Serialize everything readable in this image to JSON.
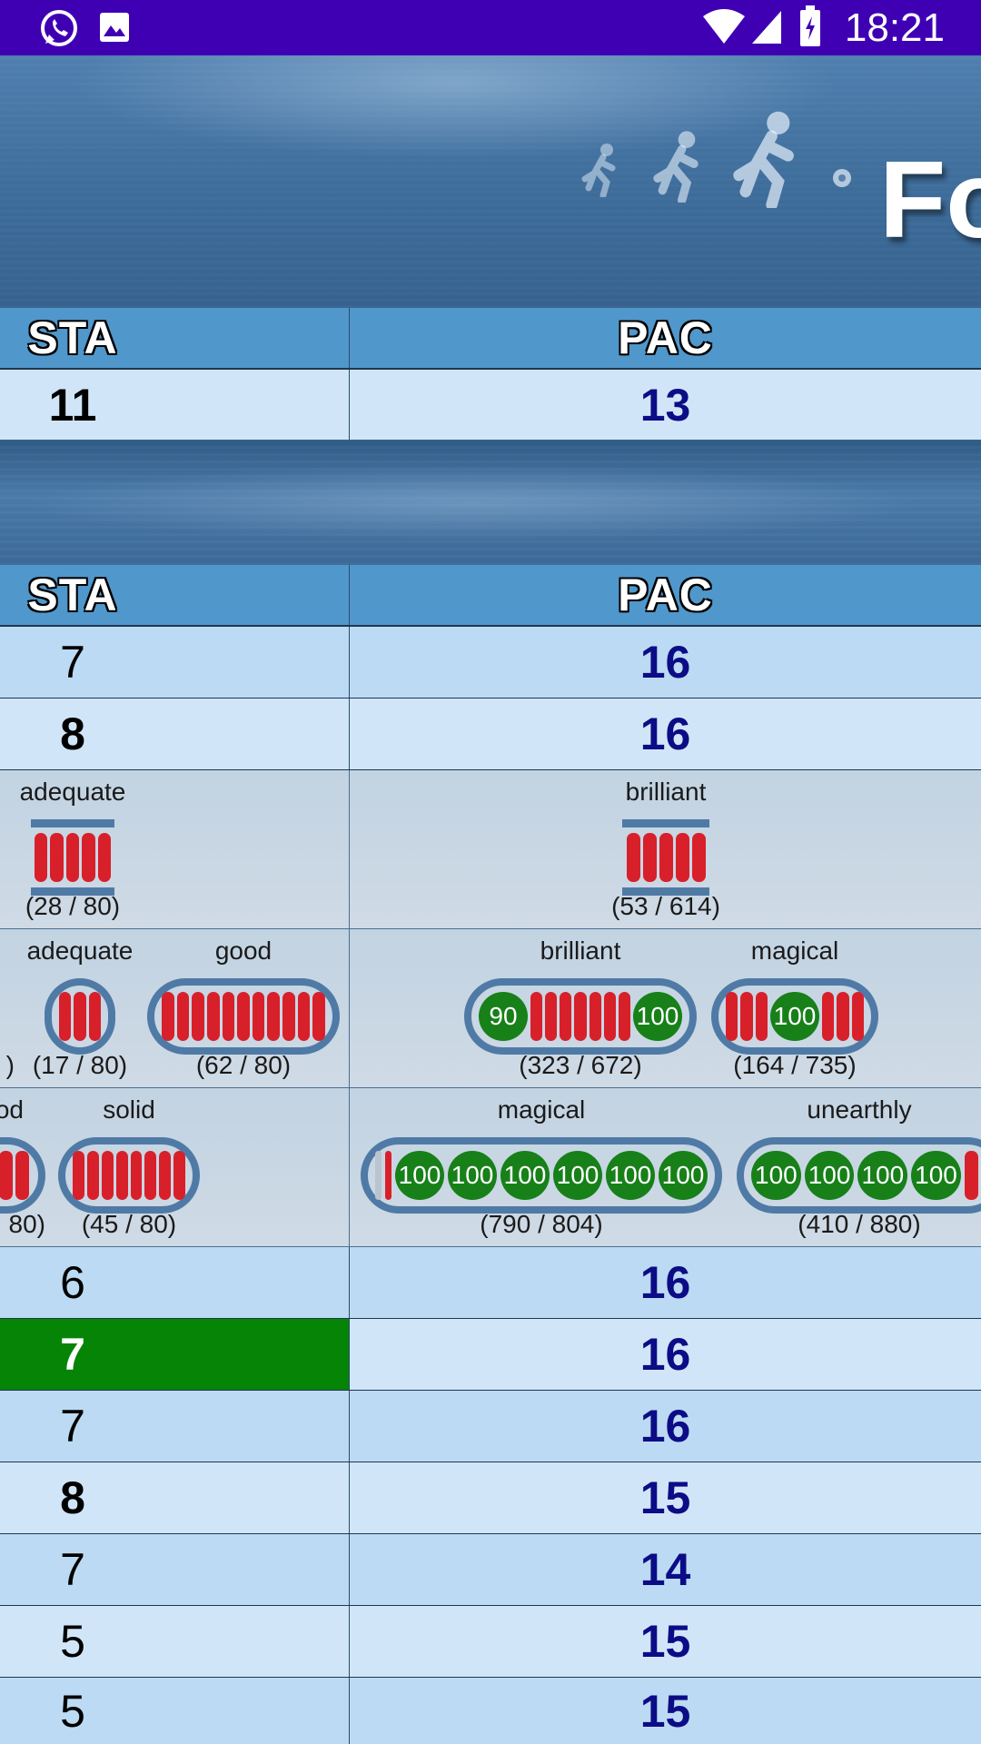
{
  "status_bar": {
    "time": "18:21",
    "left_icons": [
      "whatsapp-icon",
      "image-icon"
    ],
    "right_icons": [
      "wifi-icon",
      "signal-icon",
      "battery-icon"
    ]
  },
  "banner": {
    "title": "Fo"
  },
  "table1": {
    "headers": [
      "STA",
      "PAC"
    ],
    "row": [
      "11",
      "13"
    ]
  },
  "table2": {
    "headers": [
      "STA",
      "PAC"
    ],
    "rows_top": [
      [
        "7",
        "16"
      ],
      [
        "8",
        "16"
      ]
    ],
    "meters": {
      "row1": [
        {
          "label": "adequate",
          "count": "(28 / 80)"
        },
        {
          "label": "brilliant",
          "count": "(53 / 614)"
        }
      ],
      "row2": [
        {
          "label": "",
          "count": ")"
        },
        {
          "label": "adequate",
          "count": "(17 / 80)"
        },
        {
          "label": "good",
          "count": "(62 / 80)"
        },
        {
          "label": "brilliant",
          "count": "(323 / 672)",
          "values": [
            "90",
            "100"
          ]
        },
        {
          "label": "magical",
          "count": "(164 / 735)",
          "values": [
            "100"
          ]
        }
      ],
      "row3": [
        {
          "label": "od",
          "count": "80)"
        },
        {
          "label": "solid",
          "count": "(45 / 80)"
        },
        {
          "label": "magical",
          "count": "(790 / 804)",
          "values": [
            "100",
            "100",
            "100",
            "100",
            "100",
            "100"
          ]
        },
        {
          "label": "unearthly",
          "count": "(410 / 880)",
          "values": [
            "100",
            "100",
            "100",
            "100"
          ]
        }
      ]
    },
    "rows_bottom": [
      [
        "6",
        "16"
      ],
      [
        "7",
        "16"
      ],
      [
        "7",
        "16"
      ],
      [
        "8",
        "15"
      ],
      [
        "7",
        "14"
      ],
      [
        "5",
        "15"
      ],
      [
        "5",
        "15"
      ]
    ]
  },
  "colors": {
    "status_bar": "#3f00b4",
    "header": "#5097cc",
    "row_a": "#bcdaf3",
    "row_b": "#d0e6f8",
    "highlight": "#068406",
    "pac_value": "#0c0c86",
    "meter_red": "#d8202a",
    "meter_green": "#178019"
  }
}
